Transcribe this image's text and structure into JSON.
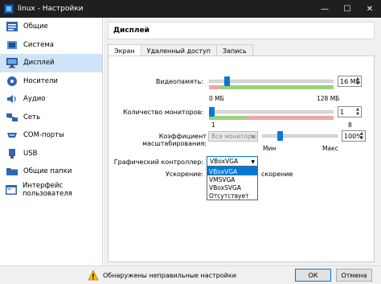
{
  "window": {
    "title": "linux - Настройки",
    "minimize": "—",
    "maximize": "☐",
    "close": "✕"
  },
  "sidebar": {
    "items": [
      {
        "label": "Общие",
        "icon": "general-icon"
      },
      {
        "label": "Система",
        "icon": "system-icon"
      },
      {
        "label": "Дисплей",
        "icon": "display-icon",
        "active": true
      },
      {
        "label": "Носители",
        "icon": "storage-icon"
      },
      {
        "label": "Аудио",
        "icon": "audio-icon"
      },
      {
        "label": "Сеть",
        "icon": "network-icon"
      },
      {
        "label": "COM-порты",
        "icon": "serial-ports-icon"
      },
      {
        "label": "USB",
        "icon": "usb-icon"
      },
      {
        "label": "Общие папки",
        "icon": "shared-folders-icon"
      },
      {
        "label": "Интерфейс пользователя",
        "icon": "user-interface-icon"
      }
    ]
  },
  "main": {
    "section_title": "Дисплей",
    "tabs": [
      "Экран",
      "Удаленный доступ",
      "Запись"
    ],
    "active_tab": 0,
    "video_memory": {
      "label": "Видеопамять:",
      "value": "16 МБ",
      "min": "0 МБ",
      "max": "128 МБ",
      "level": 0.125
    },
    "monitors": {
      "label": "Количество мониторов:",
      "value": "1",
      "min": "1",
      "max": "8",
      "level": 0.0
    },
    "scale": {
      "label": "Коэффициент масштабирования:",
      "combo": "Все мониторы",
      "value": "100%",
      "min": "Мин",
      "max": "Макс",
      "level": 0.22
    },
    "graphics_controller": {
      "label": "Графический контроллер:",
      "value": "VBoxVGA",
      "options": [
        "VBoxVGA",
        "VMSVGA",
        "VBoxSVGA",
        "Отсутствует"
      ],
      "selected_index": 0
    },
    "acceleration": {
      "label": "Ускорение:",
      "trailing_text": "скорение"
    }
  },
  "bottom": {
    "warning": "Обнаружены неправильные настройки",
    "ok": "ОК",
    "cancel": "Отмена"
  },
  "colors": {
    "titlebar": "#1f1f1f",
    "accent": "#0078d7",
    "sidebar_active": "#cfe4f8",
    "slider_handle": "#0a78d7",
    "green_zone": "#9bd27a",
    "red_zone": "#f0a6a6"
  }
}
